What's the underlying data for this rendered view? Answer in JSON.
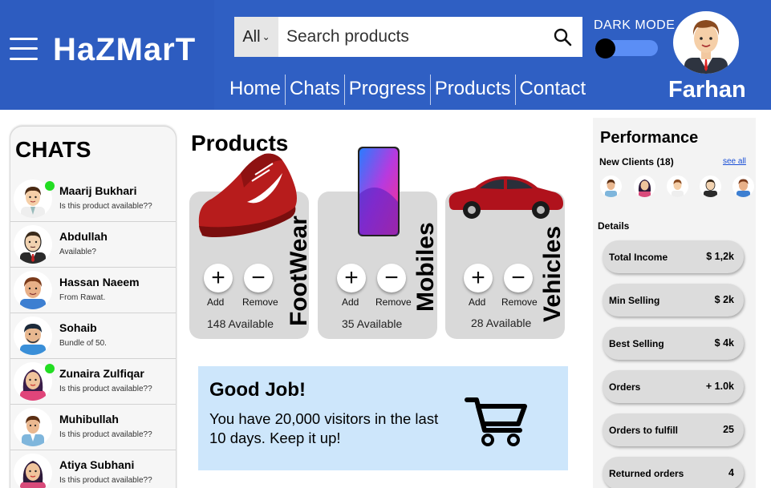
{
  "header": {
    "brand": "HaZMarT",
    "search": {
      "category": "All",
      "placeholder": "Search products"
    },
    "dark_mode_label": "DARK MODE",
    "username": "Farhan",
    "nav": [
      "Home",
      "Chats",
      "Progress",
      "Products",
      "Contact"
    ]
  },
  "chats": {
    "title": "CHATS",
    "items": [
      {
        "name": "Maarij Bukhari",
        "message": "Is this product available??",
        "online": true
      },
      {
        "name": "Abdullah",
        "message": "Available?",
        "online": false
      },
      {
        "name": "Hassan Naeem",
        "message": "From Rawat.",
        "online": false
      },
      {
        "name": "Sohaib",
        "message": "Bundle of 50.",
        "online": false
      },
      {
        "name": "Zunaira Zulfiqar",
        "message": "Is this product available??",
        "online": true
      },
      {
        "name": "Muhibullah",
        "message": "Is this product available??",
        "online": false
      },
      {
        "name": "Atiya Subhani",
        "message": "Is this product available??",
        "online": false
      }
    ]
  },
  "products": {
    "title": "Products",
    "add_label": "Add",
    "remove_label": "Remove",
    "items": [
      {
        "category": "FootWear",
        "available": "148 Available"
      },
      {
        "category": "Mobiles",
        "available": "35 Available"
      },
      {
        "category": "Vehicles",
        "available": "28 Available"
      }
    ]
  },
  "goodjob": {
    "title": "Good Job!",
    "text": "You have 20,000 visitors in the last 10 days. Keep it up!"
  },
  "performance": {
    "title": "Performance",
    "new_clients_label": "New Clients (18)",
    "see_all": "see all",
    "details_label": "Details",
    "stats": [
      {
        "label": "Total Income",
        "value": "$ 1,2k"
      },
      {
        "label": "Min Selling",
        "value": "$ 2k"
      },
      {
        "label": "Best Selling",
        "value": "$ 4k"
      },
      {
        "label": "Orders",
        "value": "+ 1.0k"
      },
      {
        "label": "Orders to fulfill",
        "value": "25"
      },
      {
        "label": "Returned orders",
        "value": "4"
      }
    ]
  },
  "colors": {
    "header_blue": "#2f5fc3",
    "toggle_blue": "#5b8ef5",
    "online_green": "#22dd22",
    "banner_blue": "#cde6fb",
    "card_grey": "#d9d9d9"
  }
}
